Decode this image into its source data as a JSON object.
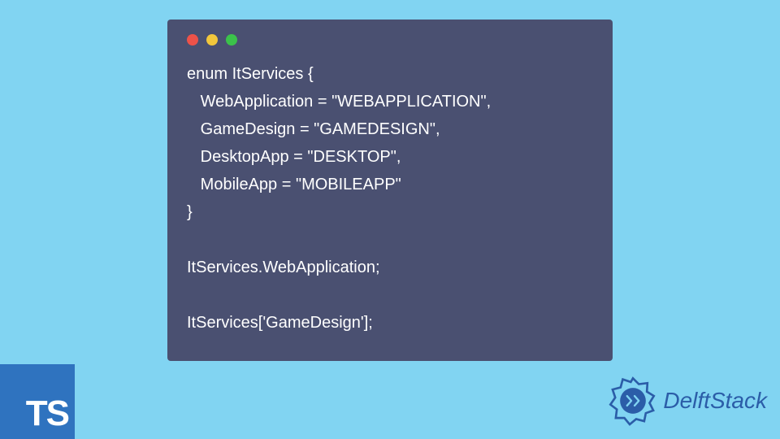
{
  "code": {
    "lines": [
      "enum ItServices {",
      "   WebApplication = \"WEBAPPLICATION\",",
      "   GameDesign = \"GAMEDESIGN\",",
      "   DesktopApp = \"DESKTOP\",",
      "   MobileApp = \"MOBILEAPP\"",
      "}",
      "",
      "ItServices.WebApplication;",
      "",
      "ItServices['GameDesign'];"
    ]
  },
  "badge": {
    "text": "TS"
  },
  "brand": {
    "name": "DelftStack"
  }
}
